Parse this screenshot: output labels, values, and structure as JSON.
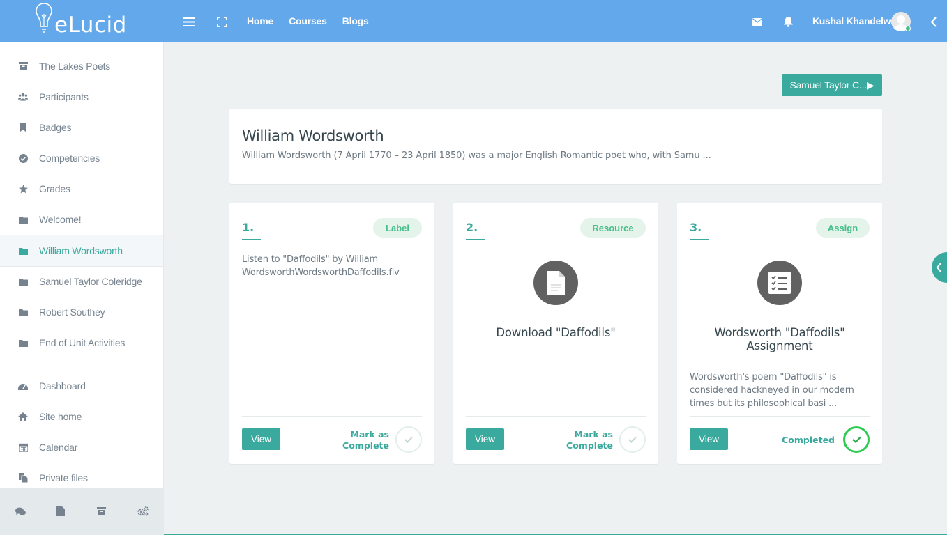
{
  "app": {
    "logo_text": "eLucid"
  },
  "topbar": {
    "nav": [
      "Home",
      "Courses",
      "Blogs"
    ],
    "user_name": "Kushal Khandelwal"
  },
  "sidebar": {
    "items": [
      {
        "label": "The Lakes Poets",
        "icon": "archive-icon"
      },
      {
        "label": "Participants",
        "icon": "users-icon"
      },
      {
        "label": "Badges",
        "icon": "bookmark-icon"
      },
      {
        "label": "Competencies",
        "icon": "check-circle-icon"
      },
      {
        "label": "Grades",
        "icon": "star-icon"
      },
      {
        "label": "Welcome!",
        "icon": "folder-icon"
      },
      {
        "label": "William Wordsworth",
        "icon": "folder-icon",
        "active": true
      },
      {
        "label": "Samuel Taylor Coleridge",
        "icon": "folder-icon"
      },
      {
        "label": "Robert Southey",
        "icon": "folder-icon"
      },
      {
        "label": "End of Unit Activities",
        "icon": "folder-icon"
      },
      {
        "label": "Dashboard",
        "icon": "dashboard-icon"
      },
      {
        "label": "Site home",
        "icon": "home-icon"
      },
      {
        "label": "Calendar",
        "icon": "calendar-icon"
      },
      {
        "label": "Private files",
        "icon": "files-icon"
      }
    ]
  },
  "main": {
    "next_button": "Samuel Taylor C...▶",
    "section_title": "William Wordsworth",
    "section_summary": "William Wordsworth (7 April 1770 – 23 April 1850) was a major English Romantic poet who, with Samu ...",
    "cards": [
      {
        "number": "1.",
        "type": "Label",
        "text": "Listen to \"Daffodils\" by William WordsworthWordsworthDaffodils.flv",
        "view": "View",
        "status": "Mark as Complete",
        "status_line1": "Mark as",
        "status_line2": "Complete"
      },
      {
        "number": "2.",
        "type": "Resource",
        "title": "Download \"Daffodils\"",
        "icon": "document-icon",
        "view": "View",
        "status_line1": "Mark as",
        "status_line2": "Complete"
      },
      {
        "number": "3.",
        "type": "Assign",
        "title": "Wordsworth \"Daffodils\" Assignment",
        "icon": "checklist-icon",
        "text": "Wordsworth's poem \"Daffodils\" is considered hackneyed in our modern times but its philosophical basi ...",
        "view": "View",
        "status": "Completed"
      }
    ]
  },
  "colors": {
    "topbar": "#62a8ea",
    "accent": "#3aa99e",
    "complete": "#2ecc52"
  }
}
